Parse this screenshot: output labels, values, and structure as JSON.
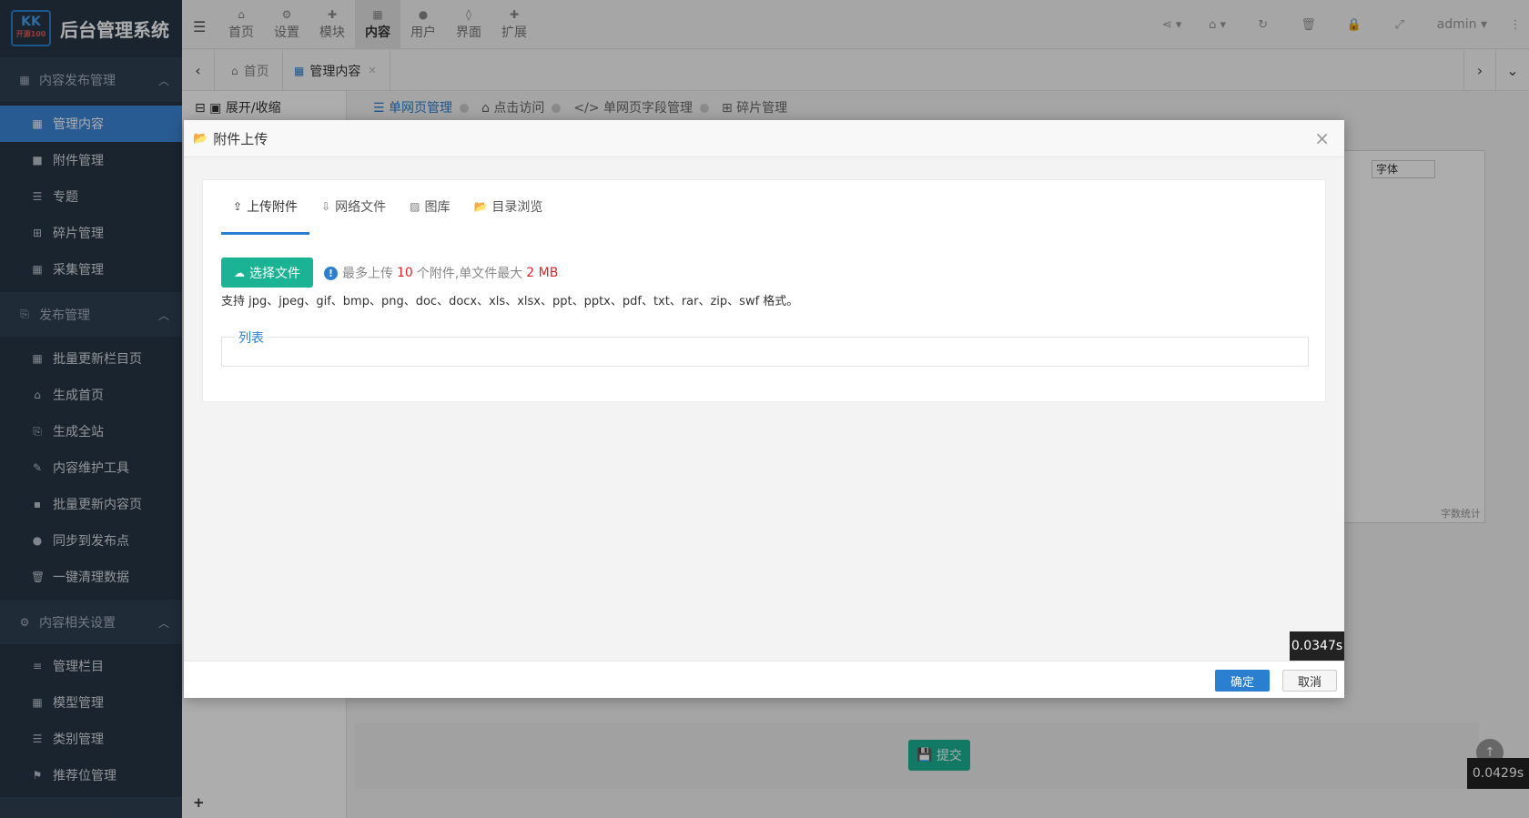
{
  "brand": {
    "logo_main": "KK",
    "logo_sub": "开源100",
    "title": "后台管理系统"
  },
  "sidebar": {
    "groups": [
      {
        "label": "内容发布管理",
        "icon": "grid-icon",
        "items": [
          {
            "label": "管理内容",
            "icon": "grid-icon",
            "active": true
          },
          {
            "label": "附件管理",
            "icon": "folder-icon"
          },
          {
            "label": "专题",
            "icon": "list-icon"
          },
          {
            "label": "碎片管理",
            "icon": "table-icon"
          },
          {
            "label": "采集管理",
            "icon": "grid-icon"
          }
        ]
      },
      {
        "label": "发布管理",
        "icon": "code-file-icon",
        "items": [
          {
            "label": "批量更新栏目页",
            "icon": "grid-icon"
          },
          {
            "label": "生成首页",
            "icon": "home-icon"
          },
          {
            "label": "生成全站",
            "icon": "code-file-icon"
          },
          {
            "label": "内容维护工具",
            "icon": "wrench-icon"
          },
          {
            "label": "批量更新内容页",
            "icon": "file-icon"
          },
          {
            "label": "同步到发布点",
            "icon": "globe-icon"
          },
          {
            "label": "一键清理数据",
            "icon": "trash-icon"
          }
        ]
      },
      {
        "label": "内容相关设置",
        "icon": "cogs-icon",
        "items": [
          {
            "label": "管理栏目",
            "icon": "bars-icon"
          },
          {
            "label": "模型管理",
            "icon": "grid-icon"
          },
          {
            "label": "类别管理",
            "icon": "list-icon"
          },
          {
            "label": "推荐位管理",
            "icon": "flag-icon"
          }
        ]
      }
    ]
  },
  "topnav": {
    "items": [
      {
        "label": "首页",
        "icon": "home-icon"
      },
      {
        "label": "设置",
        "icon": "cogs-icon"
      },
      {
        "label": "模块",
        "icon": "puzzle-icon"
      },
      {
        "label": "内容",
        "icon": "grid-icon",
        "active": true
      },
      {
        "label": "用户",
        "icon": "user-icon"
      },
      {
        "label": "界面",
        "icon": "html5-icon"
      },
      {
        "label": "扩展",
        "icon": "puzzle-icon"
      }
    ],
    "user": "admin"
  },
  "tabs": {
    "home": "首页",
    "active": "管理内容"
  },
  "tree": {
    "toggle": "展开/收缩"
  },
  "subnav": {
    "items": [
      "单网页管理",
      "点击访问",
      "单网页字段管理",
      "碎片管理"
    ]
  },
  "editor": {
    "font_label": "字体",
    "word_count": "字数统计"
  },
  "page": {
    "submit": "提交",
    "timer": "0.0429s"
  },
  "modal": {
    "title": "附件上传",
    "tabs": [
      "上传附件",
      "网络文件",
      "图库",
      "目录浏览"
    ],
    "choose_label": "选择文件",
    "limit_prefix": "最多上传",
    "max_files": "10",
    "limit_mid": "个附件,单文件最大",
    "max_size": "2 MB",
    "formats": "支持 jpg、jpeg、gif、bmp、png、doc、docx、xls、xlsx、ppt、pptx、pdf、txt、rar、zip、swf 格式。",
    "list_legend": "列表",
    "timer": "0.0347s",
    "ok": "确定",
    "cancel": "取消"
  },
  "colors": {
    "sidebar_bg": "#2f4050",
    "accent": "#2a7fd0",
    "green": "#1ab394",
    "danger": "#e0232b"
  }
}
